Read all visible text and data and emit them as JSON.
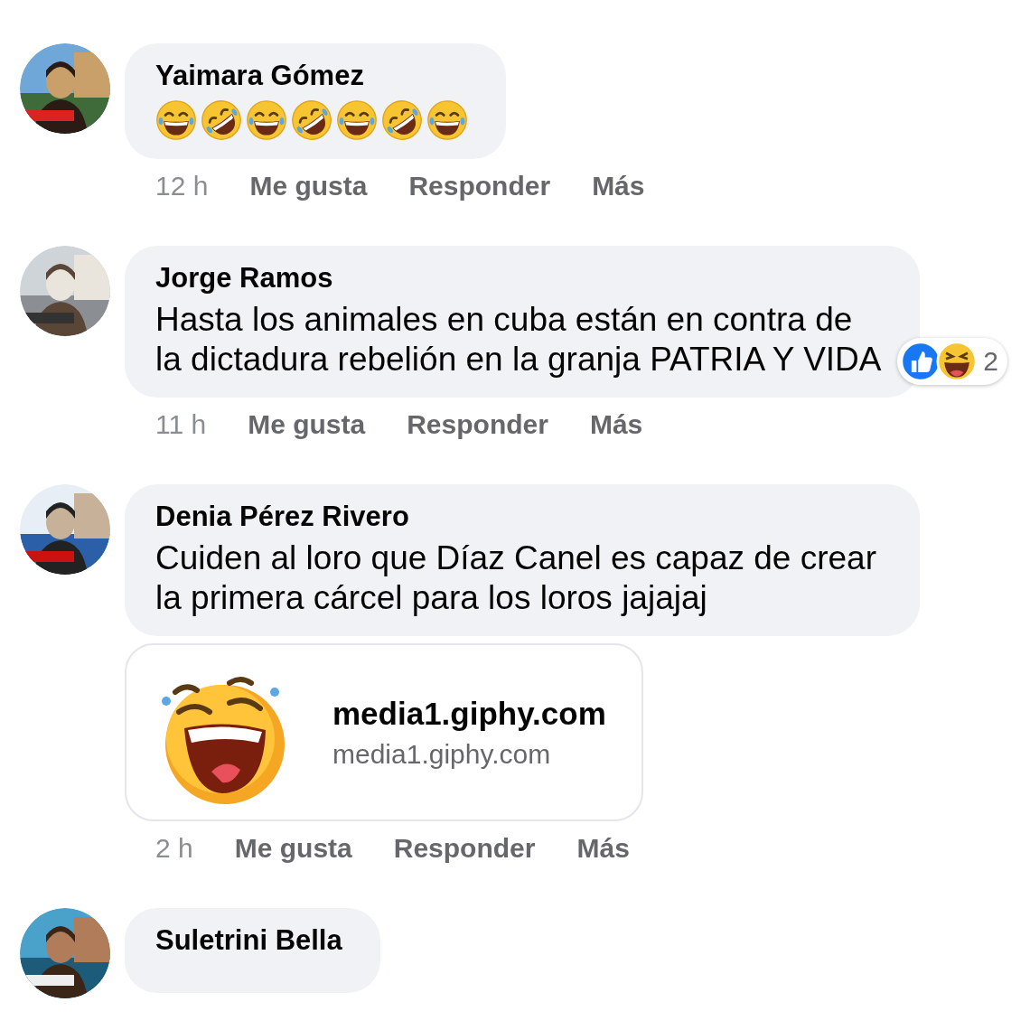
{
  "comments": [
    {
      "author": "Yaimara Gómez",
      "emojis": [
        {
          "kind": "tears"
        },
        {
          "kind": "rofl"
        },
        {
          "kind": "tears"
        },
        {
          "kind": "rofl"
        },
        {
          "kind": "tears"
        },
        {
          "kind": "rofl"
        },
        {
          "kind": "tears"
        }
      ],
      "time": "12 h",
      "actions": [
        "Me gusta",
        "Responder",
        "Más"
      ]
    },
    {
      "author": "Jorge Ramos",
      "text": "Hasta los animales en cuba están en contra de la dictadura rebelión en la granja PATRIA Y VIDA",
      "reactions": [
        {
          "kind": "like"
        },
        {
          "kind": "haha"
        }
      ],
      "reaction_count": "2",
      "time": "11 h",
      "actions": [
        "Me gusta",
        "Responder",
        "Más"
      ]
    },
    {
      "author": "Denia Pérez Rivero",
      "text": "Cuiden al loro que Díaz Canel es capaz de crear la primera cárcel para los loros jajajaj",
      "link": {
        "title": "media1.giphy.com",
        "domain": "media1.giphy.com"
      },
      "time": "2 h",
      "actions": [
        "Me gusta",
        "Responder",
        "Más"
      ]
    },
    {
      "author": "Suletrini Bella"
    }
  ]
}
